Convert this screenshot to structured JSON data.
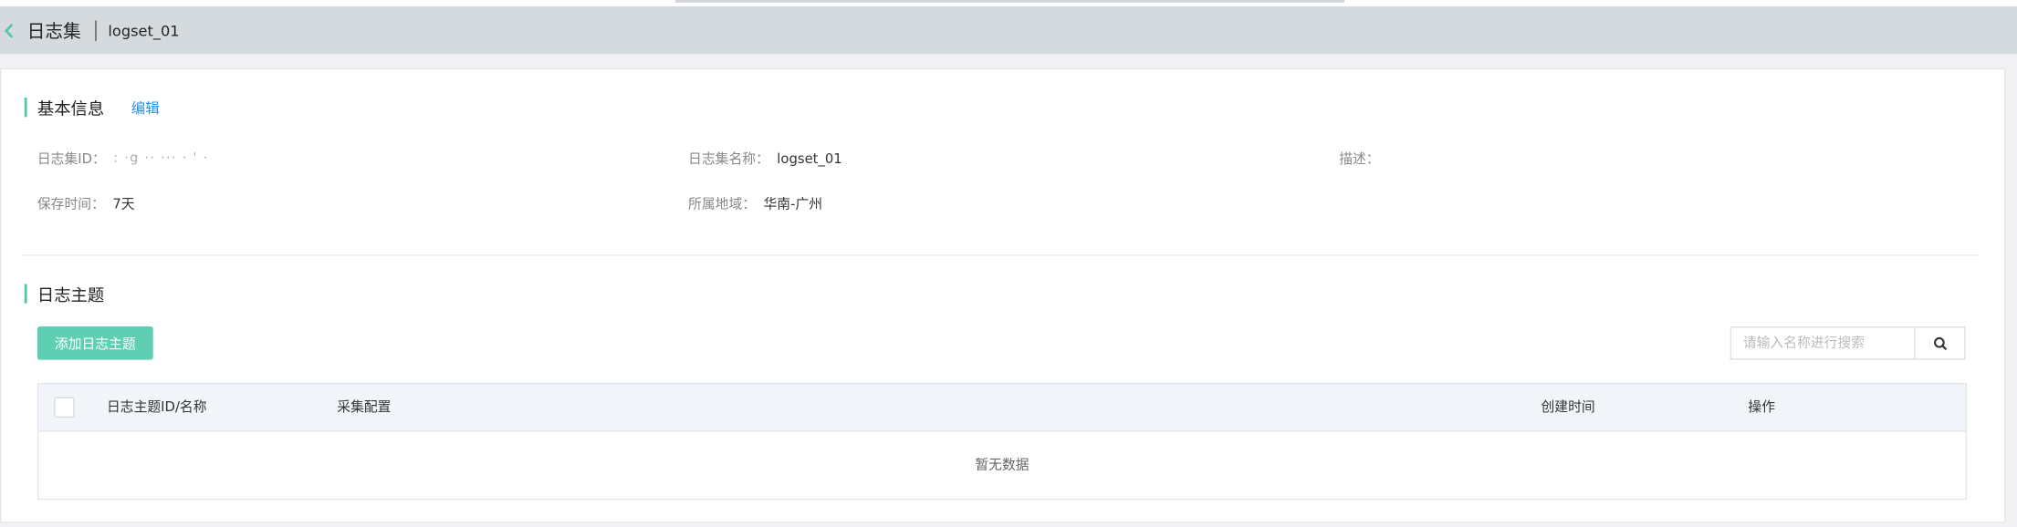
{
  "header": {
    "title": "日志集",
    "subtitle": "logset_01"
  },
  "basic_info": {
    "title": "基本信息",
    "edit_label": "编辑",
    "fields": {
      "logset_id": {
        "label": "日志集ID：",
        "value": ": ·g ·· ··· ·     ' ·"
      },
      "logset_name": {
        "label": "日志集名称：",
        "value": "logset_01"
      },
      "description": {
        "label": "描述：",
        "value": ""
      },
      "retention": {
        "label": "保存时间：",
        "value": "7天"
      },
      "region": {
        "label": "所属地域：",
        "value": "华南-广州"
      }
    }
  },
  "log_topics": {
    "title": "日志主题",
    "add_button_label": "添加日志主题",
    "search": {
      "placeholder": "请输入名称进行搜索",
      "value": ""
    },
    "table": {
      "columns": [
        "日志主题ID/名称",
        "采集配置",
        "创建时间",
        "操作"
      ],
      "rows": [],
      "empty_text": "暂无数据"
    }
  },
  "colors": {
    "accent": "#5fcfb3",
    "link": "#2b8ff0",
    "header_bg": "#d5dadf"
  },
  "icons": {
    "back": "chevron-left-icon",
    "search": "search-icon"
  }
}
